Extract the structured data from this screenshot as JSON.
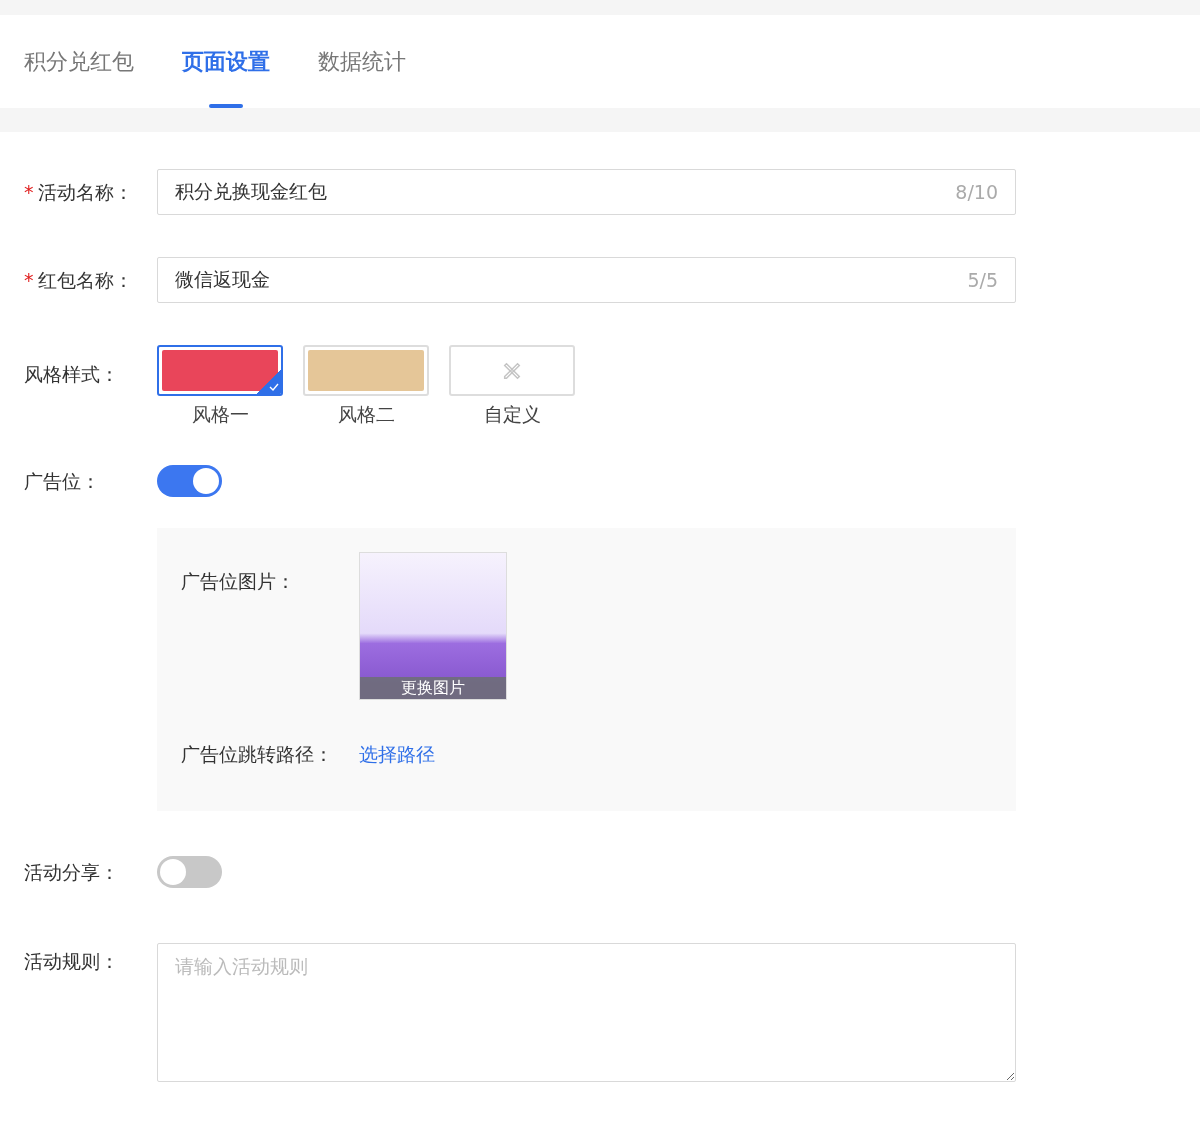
{
  "tabs": [
    {
      "label": "积分兑红包",
      "selected": false
    },
    {
      "label": "页面设置",
      "selected": true
    },
    {
      "label": "数据统计",
      "selected": false
    }
  ],
  "fields": [
    {
      "label": "活动名称：",
      "required_mark": "*",
      "value": "积分兑换现金红包",
      "count": "8/10"
    },
    {
      "label": "红包名称：",
      "required_mark": "*",
      "value": "微信返现金",
      "count": "5/5"
    }
  ],
  "style": {
    "label": "风格样式：",
    "options": [
      {
        "kind": "color",
        "label": "风格一",
        "color": "#e9455a",
        "selected": true
      },
      {
        "kind": "color",
        "label": "风格二",
        "color": "#e5c698",
        "selected": false
      },
      {
        "kind": "custom",
        "label": "自定义",
        "selected": false
      }
    ]
  },
  "ad": {
    "label": "广告位：",
    "on": true,
    "image_label": "广告位图片：",
    "change_image": "更换图片",
    "path_label": "广告位跳转路径：",
    "path_link": "选择路径"
  },
  "share": {
    "label": "活动分享：",
    "on": false
  },
  "rules": {
    "label": "活动规则：",
    "placeholder": "请输入活动规则"
  }
}
